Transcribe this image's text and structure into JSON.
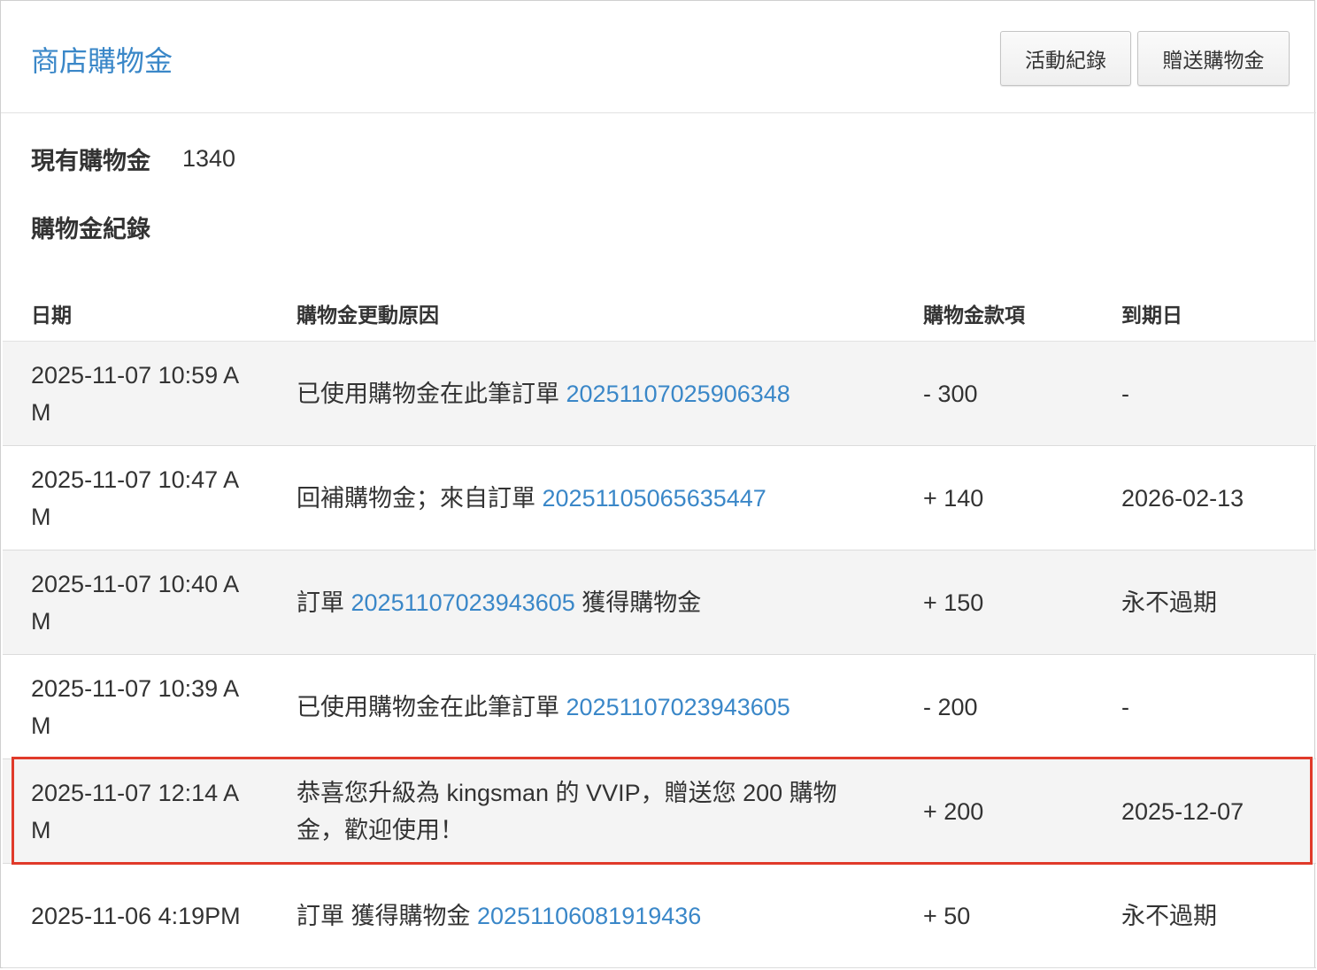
{
  "header": {
    "title": "商店購物金",
    "buttons": {
      "activity_log": "活動紀錄",
      "gift_credit": "贈送購物金"
    }
  },
  "balance": {
    "label": "現有購物金",
    "value": "1340"
  },
  "records_title": "購物金紀錄",
  "table": {
    "columns": [
      "日期",
      "購物金更動原因",
      "購物金款項",
      "到期日"
    ],
    "rows": [
      {
        "date": "2025-11-07 10:59 AM",
        "reason_before": "已使用購物金在此筆訂單 ",
        "order": "20251107025906348",
        "reason_after": "",
        "amount": "- 300",
        "expiry": "-"
      },
      {
        "date": "2025-11-07 10:47 AM",
        "reason_before": "回補購物金；來自訂單 ",
        "order": "20251105065635447",
        "reason_after": "",
        "amount": "+ 140",
        "expiry": "2026-02-13"
      },
      {
        "date": "2025-11-07 10:40 AM",
        "reason_before": "訂單 ",
        "order": "20251107023943605",
        "reason_after": " 獲得購物金",
        "amount": "+ 150",
        "expiry": "永不過期"
      },
      {
        "date": "2025-11-07 10:39 AM",
        "reason_before": "已使用購物金在此筆訂單 ",
        "order": "20251107023943605",
        "reason_after": "",
        "amount": "- 200",
        "expiry": "-"
      },
      {
        "date": "2025-11-07 12:14 AM",
        "reason_before": "恭喜您升級為 kingsman 的 VVIP，贈送您 200 購物金，歡迎使用！",
        "order": "",
        "reason_after": "",
        "amount": "+ 200",
        "expiry": "2025-12-07"
      },
      {
        "date": "2025-11-06 4:19PM",
        "reason_before": "訂單 獲得購物金 ",
        "order": "20251106081919436",
        "reason_after": "",
        "amount": "+ 50",
        "expiry": "永不過期"
      }
    ]
  },
  "colors": {
    "accent": "#3a87c8",
    "highlight_border": "#e03a2a",
    "alt_row": "#f4f4f4"
  }
}
